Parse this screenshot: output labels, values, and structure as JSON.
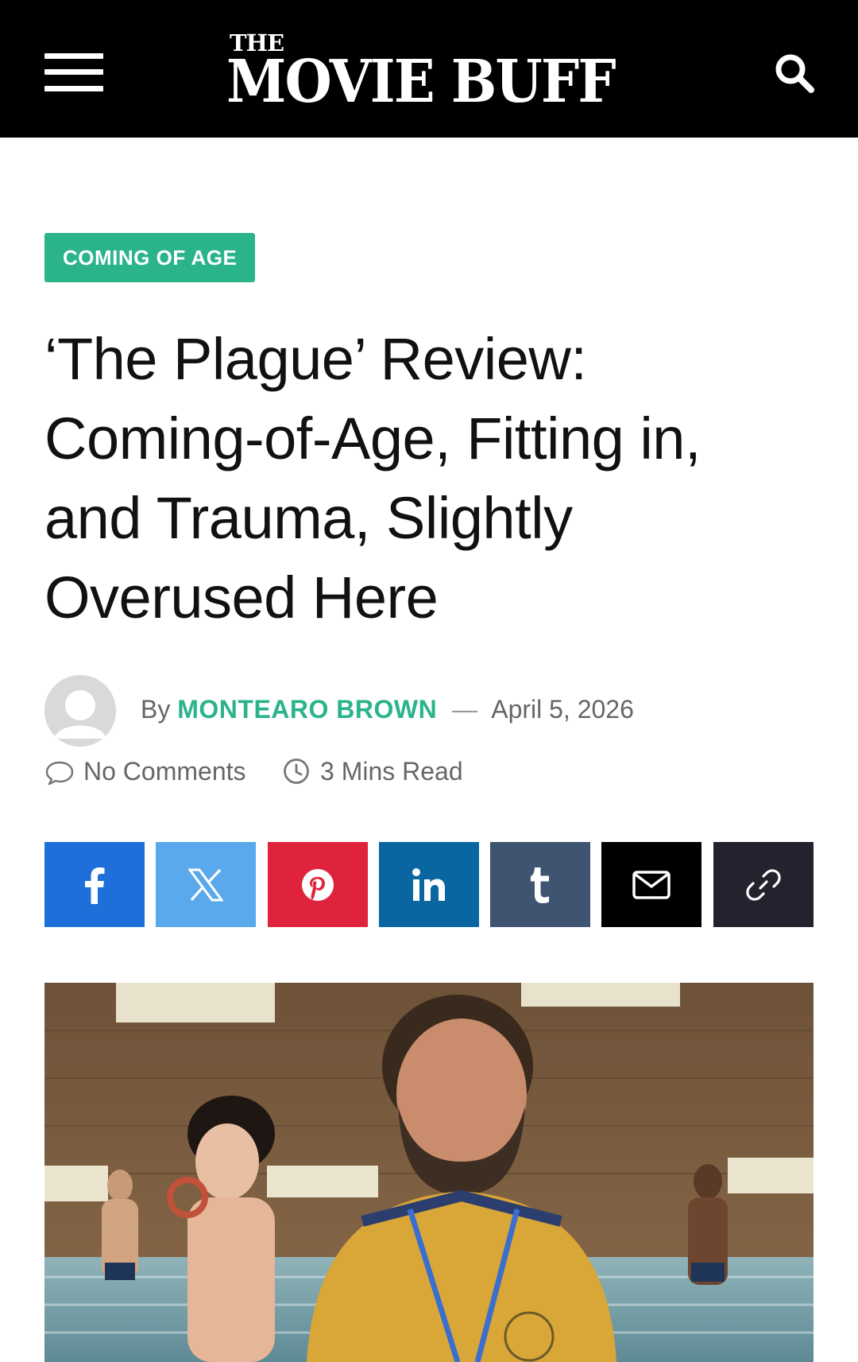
{
  "header": {
    "logo_small": "THE",
    "logo_big": "MOVIE BUFF"
  },
  "article": {
    "category": "COMING OF AGE",
    "title": "‘The Plague’ Review: Coming-of-Age, Fitting in, and Trauma, Slightly Overused Here",
    "byline_prefix": "By",
    "author": "MONTEARO BROWN",
    "dash": "—",
    "date": "April 5, 2026",
    "comments": "No Comments",
    "read_time": "3 Mins Read"
  },
  "share_buttons": [
    {
      "icon": "facebook-icon",
      "color": "#1e6fd9"
    },
    {
      "icon": "x-icon",
      "color": "#5aa9ec"
    },
    {
      "icon": "pinterest-icon",
      "color": "#e0233c"
    },
    {
      "icon": "linkedin-icon",
      "color": "#0a66a0"
    },
    {
      "icon": "tumblr-icon",
      "color": "#3f5470"
    },
    {
      "icon": "email-icon",
      "color": "#000000"
    },
    {
      "icon": "link-icon",
      "color": "#22232e"
    }
  ],
  "colors": {
    "accent": "#2bb38b",
    "header_bg": "#000000"
  }
}
